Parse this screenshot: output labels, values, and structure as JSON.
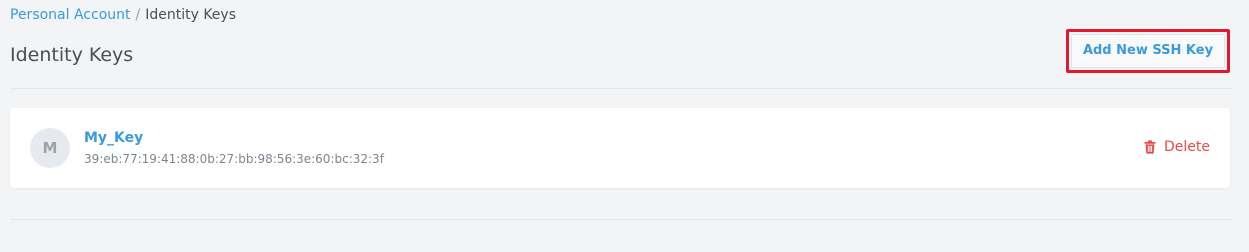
{
  "breadcrumb": {
    "parent": "Personal Account",
    "separator": "/",
    "current": "Identity Keys"
  },
  "page": {
    "title": "Identity Keys"
  },
  "actions": {
    "add_key_label": "Add New SSH Key"
  },
  "keys": [
    {
      "avatar_letter": "M",
      "name": "My_Key",
      "fingerprint": "39:eb:77:19:41:88:0b:27:bb:98:56:3e:60:bc:32:3f",
      "delete_label": "Delete",
      "delete_icon": "trash-icon"
    }
  ],
  "colors": {
    "link": "#3b9ad9",
    "danger": "#e64a4a",
    "highlight": "#e0192e",
    "background": "#f3f4f6"
  }
}
